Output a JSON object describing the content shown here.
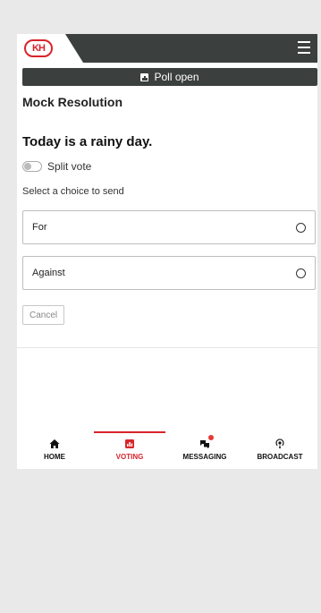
{
  "header": {
    "logo_text": "KH",
    "menu_icon": "hamburger-menu-icon"
  },
  "poll_status": {
    "icon": "bar-chart-icon",
    "label": "Poll open"
  },
  "resolution": {
    "title": "Mock Resolution",
    "question": "Today is a rainy day."
  },
  "split_vote": {
    "label": "Split vote",
    "enabled": false
  },
  "choices": {
    "prompt": "Select a choice to send",
    "items": [
      {
        "label": "For"
      },
      {
        "label": "Against"
      }
    ]
  },
  "actions": {
    "cancel_label": "Cancel"
  },
  "nav": {
    "items": [
      {
        "label": "HOME",
        "icon": "home-icon",
        "active": false
      },
      {
        "label": "VOTING",
        "icon": "voting-icon",
        "active": true
      },
      {
        "label": "MESSAGING",
        "icon": "messaging-icon",
        "active": false,
        "notification": true
      },
      {
        "label": "BROADCAST",
        "icon": "broadcast-icon",
        "active": false
      }
    ]
  },
  "colors": {
    "brand": "#d8242a",
    "header_bg": "#3b3f3d",
    "page_bg": "#e9e9e9"
  }
}
